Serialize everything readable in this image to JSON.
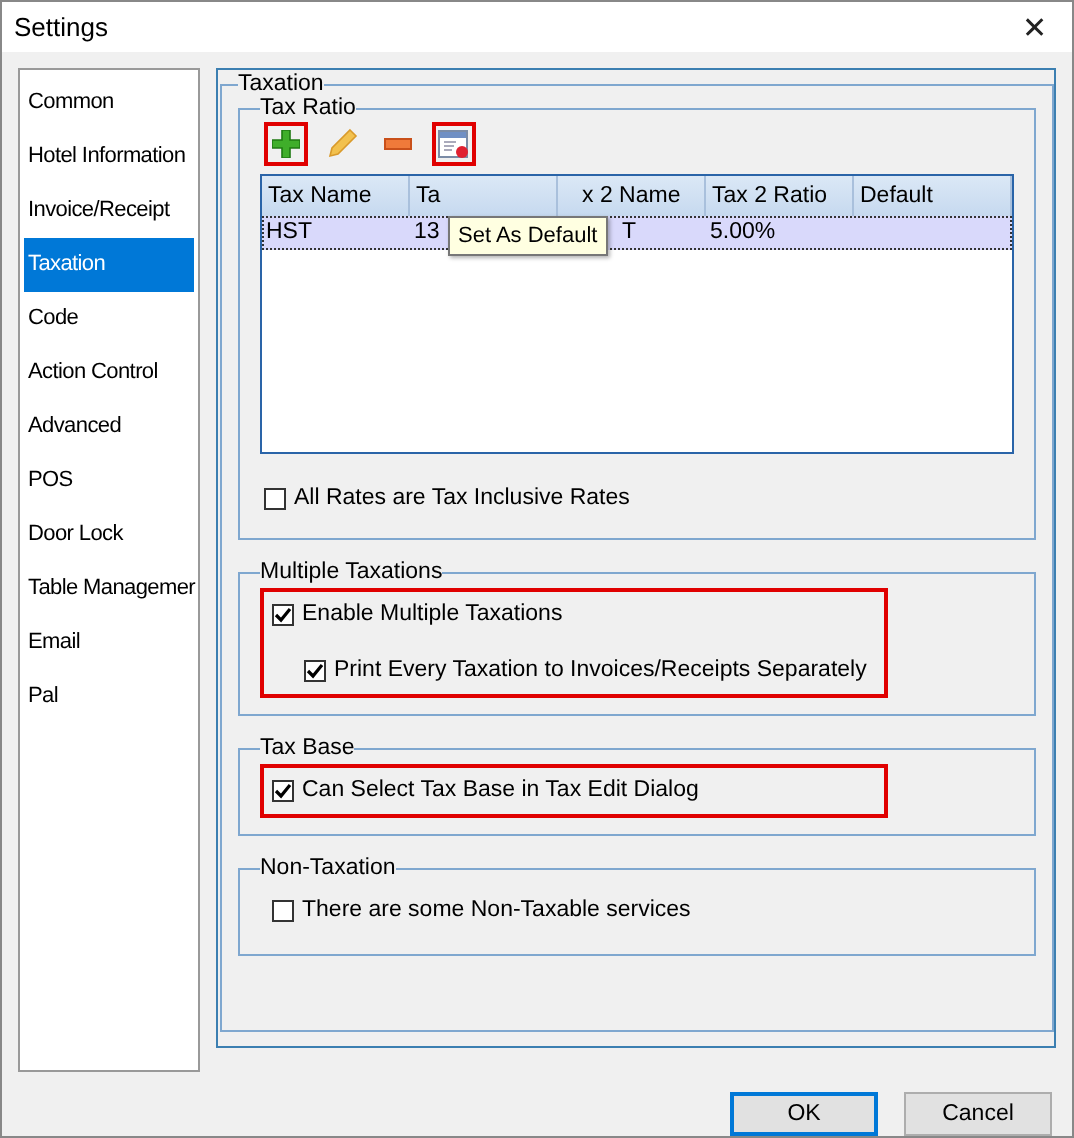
{
  "window": {
    "title": "Settings",
    "close": "✕"
  },
  "sidebar": {
    "items": [
      {
        "label": "Common",
        "selected": false
      },
      {
        "label": "Hotel Information",
        "selected": false
      },
      {
        "label": "Invoice/Receipt",
        "selected": false
      },
      {
        "label": "Taxation",
        "selected": true
      },
      {
        "label": "Code",
        "selected": false
      },
      {
        "label": "Action Control",
        "selected": false
      },
      {
        "label": "Advanced",
        "selected": false
      },
      {
        "label": "POS",
        "selected": false
      },
      {
        "label": "Door Lock",
        "selected": false
      },
      {
        "label": "Table Managemer",
        "selected": false
      },
      {
        "label": "Email",
        "selected": false
      },
      {
        "label": "Pal",
        "selected": false
      }
    ]
  },
  "panel": {
    "title": "Taxation",
    "tax_ratio": {
      "title": "Tax Ratio",
      "toolbar": [
        {
          "kind": "add",
          "highlighted": true
        },
        {
          "kind": "edit",
          "highlighted": false
        },
        {
          "kind": "remove",
          "highlighted": false
        },
        {
          "kind": "set_default",
          "highlighted": true
        }
      ],
      "tooltip": "Set As Default",
      "table": {
        "columns": [
          "Tax Name",
          "Ta",
          "x 2 Name",
          "Tax 2 Ratio",
          "Default"
        ],
        "rows": [
          {
            "selected": true,
            "cells": [
              "HST",
              "13",
              "T",
              "5.00%"
            ]
          }
        ]
      },
      "options": [
        {
          "label": "All Rates are Tax Inclusive Rates",
          "checked": false,
          "indented": false
        }
      ]
    },
    "sections": [
      {
        "title": "Multiple Taxations",
        "highlighted": true,
        "options": [
          {
            "label": "Enable Multiple Taxations",
            "checked": true,
            "indented": false
          },
          {
            "label": "Print Every Taxation to Invoices/Receipts Separately",
            "checked": true,
            "indented": true
          }
        ]
      },
      {
        "title": "Tax Base",
        "highlighted": true,
        "options": [
          {
            "label": "Can Select Tax Base in Tax Edit Dialog",
            "checked": true,
            "indented": false
          }
        ]
      },
      {
        "title": "Non-Taxation",
        "highlighted": false,
        "options": [
          {
            "label": "There are some Non-Taxable services",
            "checked": false,
            "indented": false
          }
        ]
      }
    ]
  },
  "buttons": [
    {
      "label": "OK",
      "default": true
    },
    {
      "label": "Cancel",
      "default": false
    }
  ]
}
